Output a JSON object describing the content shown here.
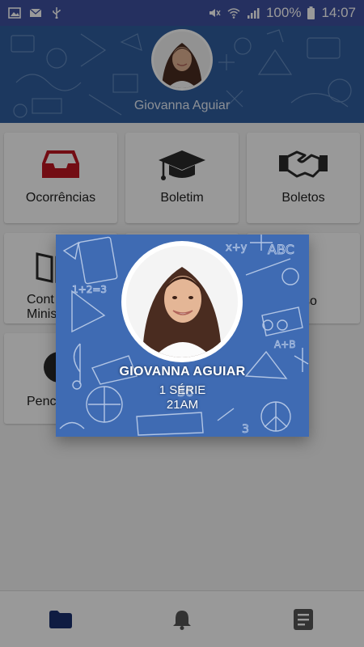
{
  "status_bar": {
    "battery": "100%",
    "time": "14:07",
    "icons": [
      "image-icon",
      "mail-icon",
      "usb-icon",
      "mute-icon",
      "wifi-icon",
      "signal-icon",
      "battery-icon"
    ]
  },
  "header": {
    "user_name": "Giovanna Aguiar"
  },
  "tiles": {
    "ocorrencias": "Ocorrências",
    "boletim": "Boletim",
    "boletos": "Boletos",
    "row2_left_line1": "Cont",
    "row2_left_line2": "Minis",
    "row2_right": "so",
    "row3_left": "Penc"
  },
  "popup": {
    "name": "GIOVANNA AGUIAR",
    "grade": "1 SÉRIE",
    "class": "21AM"
  },
  "colors": {
    "status_bar": "#3f51a1",
    "header_bg": "#2f5e9e",
    "popup_bg": "#3f6bb3",
    "inbox_icon": "#c01722",
    "dark_icon": "#333333",
    "nav_active": "#1a2f6e",
    "nav_inactive": "#555555"
  },
  "bottom_nav": {
    "items": [
      "folder-icon",
      "bell-icon",
      "document-icon"
    ],
    "active": "folder-icon"
  }
}
